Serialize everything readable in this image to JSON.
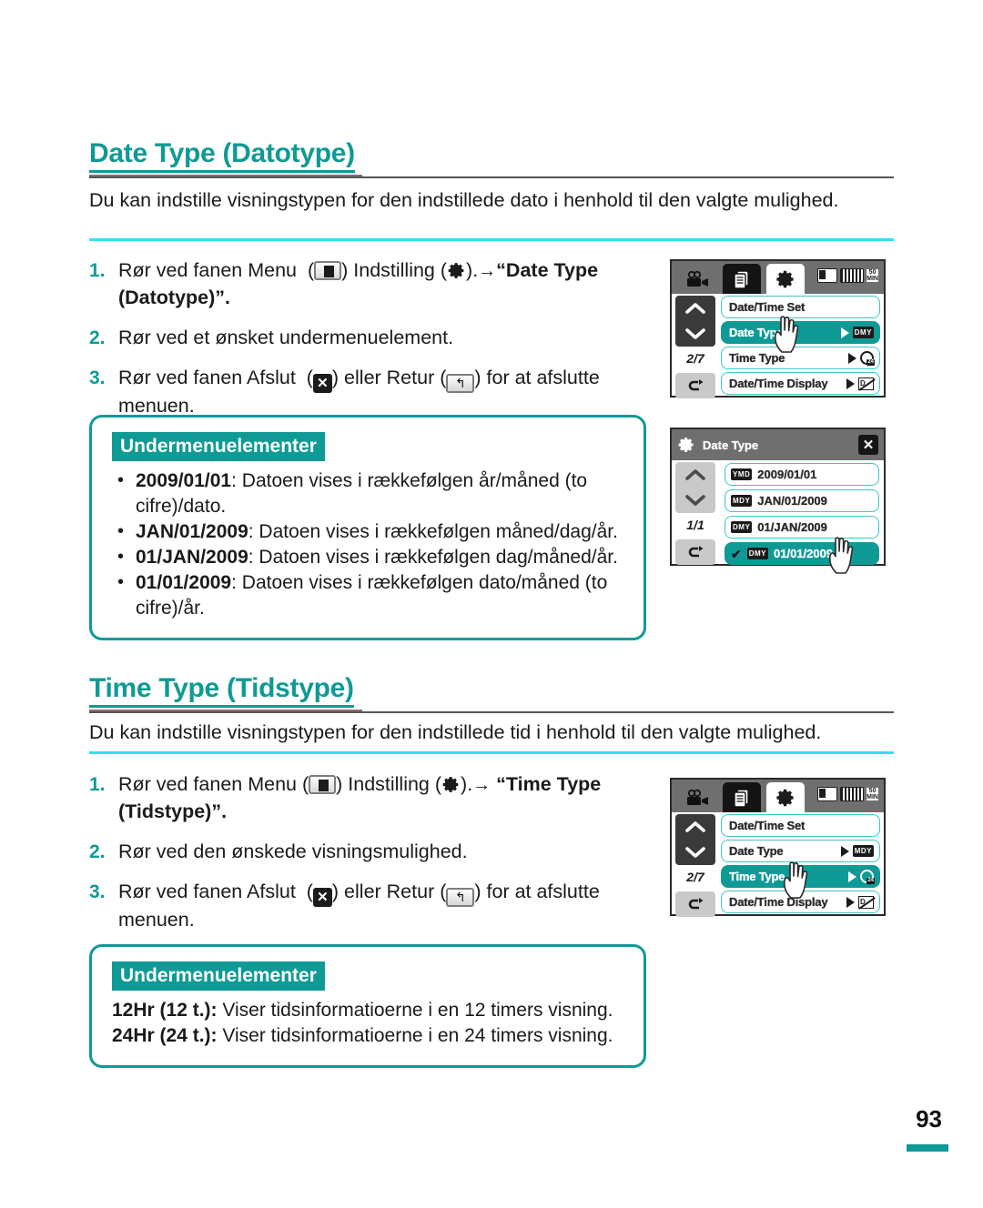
{
  "page": {
    "number": "93"
  },
  "sections": [
    {
      "id": "date-type",
      "title": "Date Type (Datotype)",
      "intro": "Du kan indstille visningstypen for den indstillede dato i henhold til den valgte mulighed.",
      "steps": [
        {
          "num": "1.",
          "parts": {
            "a": "Rør ved fanen Menu",
            "b": ") Indstilling (",
            "c": ").",
            "d": "“Date Type (Datotype)”."
          }
        },
        {
          "num": "2.",
          "text": "Rør ved et ønsket undermenuelement."
        },
        {
          "num": "3.",
          "parts": {
            "a": "Rør ved fanen Afslut",
            "b": ") eller Retur (",
            "c": ") for at afslutte menuen."
          }
        }
      ],
      "infobox": {
        "badge": "Undermenuelementer",
        "items": [
          {
            "term": "2009/01/01",
            "desc": ": Datoen vises i rækkefølgen år/måned (to cifre)/dato."
          },
          {
            "term": "JAN/01/2009",
            "desc": ": Datoen vises i rækkefølgen måned/dag/år."
          },
          {
            "term": "01/JAN/2009",
            "desc": ": Datoen vises i rækkefølgen dag/måned/år."
          },
          {
            "term": "01/01/2009",
            "desc": ": Datoen vises i rækkefølgen dato/måned (to cifre)/år."
          }
        ]
      }
    },
    {
      "id": "time-type",
      "title": "Time Type (Tidstype)",
      "intro": "Du kan indstille visningstypen for den indstillede tid i henhold til den valgte mulighed.",
      "steps": [
        {
          "num": "1.",
          "parts": {
            "a": "Rør ved fanen Menu (",
            "b": ") Indstilling (",
            "c": ").",
            "d": "“Time Type (Tidstype)”."
          }
        },
        {
          "num": "2.",
          "text": "Rør ved den ønskede visningsmulighed."
        },
        {
          "num": "3.",
          "parts": {
            "a": "Rør ved fanen Afslut",
            "b": ") eller Retur  (",
            "c": ") for at afslutte menuen."
          }
        }
      ],
      "infobox": {
        "badge": "Undermenuelementer",
        "lines": [
          {
            "term": "12Hr (12 t.):",
            "desc": " Viser tidsinformatioerne i en 12 timers visning."
          },
          {
            "term": "24Hr (24 t.):",
            "desc": " Viser tidsinformatioerne i en 24 timers visning."
          }
        ]
      }
    }
  ],
  "screens": {
    "menu_date_type": {
      "page_indicator": "2/7",
      "tabs": [
        "movie-camera-icon",
        "document-icon",
        "gear-icon"
      ],
      "status": {
        "card": "card-icon",
        "battery": "battery-icon",
        "minutes": "50 MIN"
      },
      "rows": [
        {
          "label": "Date/Time Set",
          "selected": false,
          "value": ""
        },
        {
          "label": "Date Type",
          "selected": true,
          "value": "DMY"
        },
        {
          "label": "Time Type",
          "selected": false,
          "value": "24"
        },
        {
          "label": "Date/Time Display",
          "selected": false,
          "value": "D/T"
        }
      ]
    },
    "submenu_date_type": {
      "title": "Date Type",
      "page_indicator": "1/1",
      "rows": [
        {
          "tag": "YMD",
          "label": "2009/01/01",
          "selected": false,
          "checked": false
        },
        {
          "tag": "MDY",
          "label": "JAN/01/2009",
          "selected": false,
          "checked": false
        },
        {
          "tag": "DMY",
          "label": "01/JAN/2009",
          "selected": false,
          "checked": false
        },
        {
          "tag": "DMY",
          "label": "01/01/2009",
          "selected": true,
          "checked": true
        }
      ]
    },
    "menu_time_type": {
      "page_indicator": "2/7",
      "tabs": [
        "movie-camera-icon",
        "document-icon",
        "gear-icon"
      ],
      "status": {
        "card": "card-icon",
        "battery": "battery-icon",
        "minutes": "50 MIN"
      },
      "rows": [
        {
          "label": "Date/Time Set",
          "selected": false,
          "value": ""
        },
        {
          "label": "Date Type",
          "selected": false,
          "value": "MDY"
        },
        {
          "label": "Time Type",
          "selected": true,
          "value": "24"
        },
        {
          "label": "Date/Time Display",
          "selected": false,
          "value": "D/T"
        }
      ]
    }
  },
  "colors": {
    "accent": "#0f9a96",
    "cyan_rule": "#2fe3f0",
    "row_border": "#3fc6c6"
  }
}
